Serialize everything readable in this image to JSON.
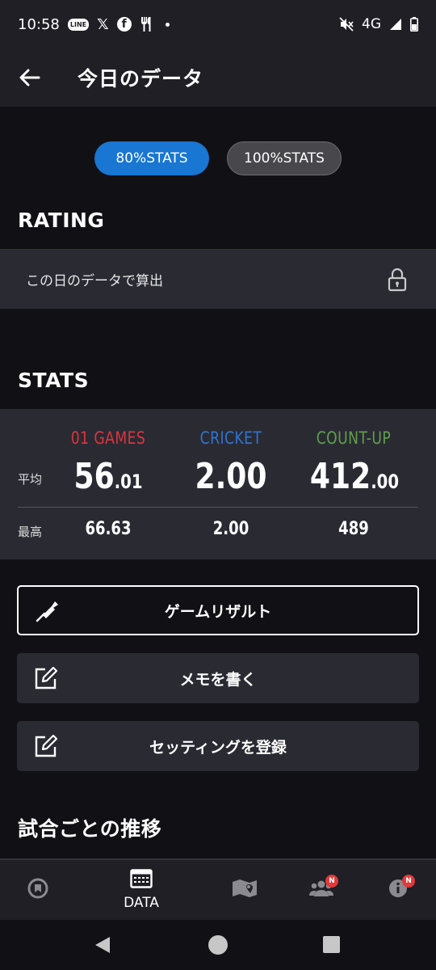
{
  "status_bar": {
    "time": "10:58",
    "notification_icons": [
      "line-icon",
      "x-icon",
      "facebook-icon",
      "restaurant-icon",
      "dot-icon"
    ],
    "line_label": "LINE",
    "x_glyph": "𝕏",
    "fb_glyph": "f",
    "network": "4G",
    "right_icons": [
      "mute-icon",
      "signal-icon",
      "battery-icon"
    ]
  },
  "app_bar": {
    "title": "今日のデータ",
    "back_icon": "back-arrow-icon"
  },
  "toggle": {
    "options": [
      "80%STATS",
      "100%STATS"
    ],
    "selected": "80%STATS"
  },
  "rating": {
    "heading": "RATING",
    "row_label": "この日のデータで算出",
    "icon": "lock-icon"
  },
  "stats": {
    "heading": "STATS",
    "row_avg_label": "平均",
    "row_best_label": "最高",
    "columns": [
      {
        "name": "01 GAMES",
        "color": "#d9363e",
        "avg_int": "56",
        "avg_dec": ".01",
        "best": "66.63"
      },
      {
        "name": "CRICKET",
        "color": "#2f74d0",
        "avg_int": "2.00",
        "avg_dec": "",
        "best": "2.00"
      },
      {
        "name": "COUNT-UP",
        "color": "#5ea04b",
        "avg_int": "412",
        "avg_dec": ".00",
        "best": "489"
      }
    ]
  },
  "actions": {
    "game_result": "ゲームリザルト",
    "write_memo": "メモを書く",
    "register_setting": "セッティングを登録"
  },
  "trend": {
    "heading": "試合ごとの推移"
  },
  "tab_bar": {
    "items": [
      {
        "icon": "home-icon",
        "label": ""
      },
      {
        "icon": "data-icon",
        "label": "DATA",
        "active": true
      },
      {
        "icon": "map-icon",
        "label": ""
      },
      {
        "icon": "friends-icon",
        "label": "",
        "badge": "N"
      },
      {
        "icon": "info-icon",
        "label": "",
        "badge": "N"
      }
    ]
  },
  "nav_bar": {
    "icons": [
      "nav-back-icon",
      "nav-home-icon",
      "nav-recents-icon"
    ]
  }
}
